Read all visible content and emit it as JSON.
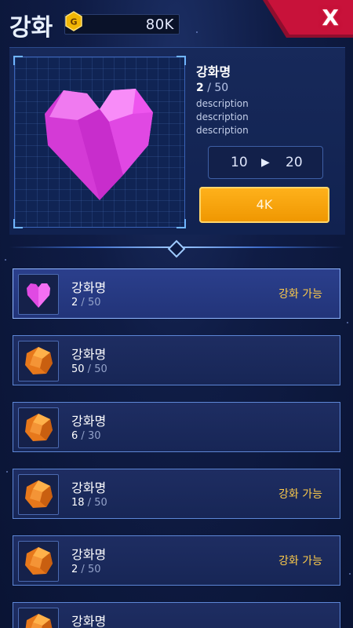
{
  "header": {
    "title": "강화",
    "gold_icon_letter": "G",
    "gold_amount": "80K",
    "close_label": "X"
  },
  "detail": {
    "name": "강화명",
    "level_current": "2",
    "level_max": "50",
    "descriptions": [
      "description",
      "description",
      "description"
    ],
    "level_from": "10",
    "level_to": "20",
    "upgrade_cost": "4K",
    "icon": "pink-heart-icon"
  },
  "items": [
    {
      "name": "강화명",
      "current": "2",
      "max": "50",
      "status": "강화 가능",
      "icon": "pink-heart-icon",
      "selected": true
    },
    {
      "name": "강화명",
      "current": "50",
      "max": "50",
      "status": "",
      "icon": "orange-orb-icon",
      "selected": false
    },
    {
      "name": "강화명",
      "current": "6",
      "max": "30",
      "status": "",
      "icon": "orange-orb-icon",
      "selected": false
    },
    {
      "name": "강화명",
      "current": "18",
      "max": "50",
      "status": "강화 가능",
      "icon": "orange-orb-icon",
      "selected": false
    },
    {
      "name": "강화명",
      "current": "2",
      "max": "50",
      "status": "강화 가능",
      "icon": "orange-orb-icon",
      "selected": false
    },
    {
      "name": "강화명",
      "current": "",
      "max": "",
      "status": "",
      "icon": "orange-orb-icon",
      "selected": false
    }
  ],
  "colors": {
    "accent_gold": "#ffcc4a",
    "button_orange": "#f5a20b",
    "close_red": "#c8123a",
    "panel_blue": "#17295a"
  }
}
